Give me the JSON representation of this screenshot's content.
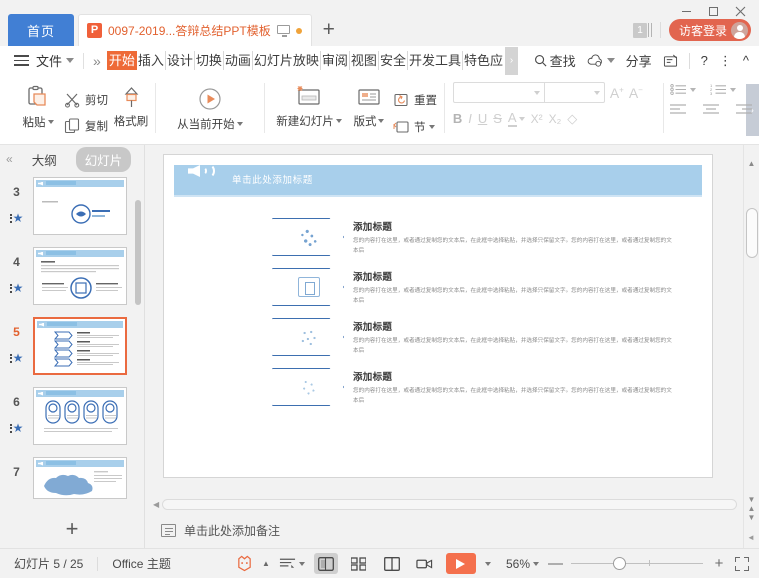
{
  "titlebar": {
    "home_tab": "首页",
    "doc_tab": {
      "badge": "P",
      "title": "0097-2019...答辩总结PPT模板"
    },
    "new_tab": "+",
    "window_count": "1",
    "guest_button": "访客登录",
    "minimize": "—",
    "maximize": "□",
    "close": "✕"
  },
  "ribbon": {
    "file_menu": "文件",
    "overflow_left": "»",
    "overflow_right": "›",
    "tabs": [
      {
        "label": "开始",
        "active": true
      },
      {
        "label": "插入",
        "active": false
      },
      {
        "label": "设计",
        "active": false
      },
      {
        "label": "切换",
        "active": false
      },
      {
        "label": "动画",
        "active": false
      },
      {
        "label": "幻灯片放映",
        "active": false
      },
      {
        "label": "审阅",
        "active": false
      },
      {
        "label": "视图",
        "active": false
      },
      {
        "label": "安全",
        "active": false
      },
      {
        "label": "开发工具",
        "active": false
      },
      {
        "label": "特色应",
        "active": false
      }
    ],
    "right_actions": [
      {
        "label": "查找",
        "icon": "search-icon"
      },
      {
        "label": "",
        "icon": "cloud-sync-icon"
      },
      {
        "label": "分享",
        "icon": "share-icon"
      },
      {
        "label": "",
        "icon": "comment-icon"
      },
      {
        "label": "?",
        "icon": "help-icon"
      },
      {
        "label": "⋮",
        "icon": "more-icon"
      },
      {
        "label": "^",
        "icon": "collapse-ribbon-icon"
      }
    ],
    "clipboard": {
      "paste": "粘贴",
      "cut": "剪切",
      "copy": "复制",
      "format_painter": "格式刷"
    },
    "slideshow": {
      "start_from_current": "从当前开始"
    },
    "slides": {
      "new_slide": "新建幻灯片",
      "layout": "版式",
      "reset": "重置",
      "section": "节"
    },
    "font": {
      "font_name_value": "",
      "font_size_value": "",
      "grow_font": "A",
      "shrink_font": "A",
      "bold": "B",
      "italic": "I",
      "underline": "U",
      "strikethrough": "S",
      "text_color": "A",
      "superscript": "X²",
      "subscript": "X₂",
      "clear_format": "◇"
    },
    "paragraph": {
      "bullets": "bullet-list-icon",
      "numbering": "numbered-list-icon",
      "align_left": "align-left-icon",
      "align_center": "align-center-icon",
      "align_right": "align-right-icon"
    }
  },
  "left_panel": {
    "collapse": "«",
    "tab_outline": "大纲",
    "tab_slides": "幻灯片",
    "selected_tab": "幻灯片",
    "add_slide": "+",
    "thumbnails": [
      {
        "number": "3",
        "selected": false
      },
      {
        "number": "4",
        "selected": false
      },
      {
        "number": "5",
        "selected": true
      },
      {
        "number": "6",
        "selected": false
      },
      {
        "number": "7",
        "selected": false
      }
    ]
  },
  "slide": {
    "title_placeholder": "单击此处添加标题",
    "items": [
      {
        "heading": "添加标题",
        "body": "您的内容打在这里，或者通过复制您的文本后，在此框中选择粘贴，并选择只保留文字。您的内容打在这里，或者通过复制您的文本后"
      },
      {
        "heading": "添加标题",
        "body": "您的内容打在这里，或者通过复制您的文本后，在此框中选择粘贴，并选择只保留文字。您的内容打在这里，或者通过复制您的文本后"
      },
      {
        "heading": "添加标题",
        "body": "您的内容打在这里，或者通过复制您的文本后，在此框中选择粘贴，并选择只保留文字。您的内容打在这里，或者通过复制您的文本后"
      },
      {
        "heading": "添加标题",
        "body": "您的内容打在这里，或者通过复制您的文本后，在此框中选择粘贴，并选择只保留文字。您的内容打在这里，或者通过复制您的文本后"
      }
    ]
  },
  "notes": {
    "placeholder": "单击此处添加备注"
  },
  "statusbar": {
    "slide_counter": "幻灯片 5 / 25",
    "theme": "Office 主题",
    "zoom_value": "56%",
    "zoom_minus": "—",
    "zoom_plus": "+",
    "play_label": "▶",
    "views": [
      {
        "name": "normal-view",
        "active": true
      },
      {
        "name": "slide-sorter-view",
        "active": false
      },
      {
        "name": "reading-view",
        "active": false
      },
      {
        "name": "presenter-view",
        "active": false
      }
    ]
  },
  "colors": {
    "accent_orange": "#ee6a37",
    "accent_blue": "#417fd4",
    "slide_banner": "#a8cfeb",
    "selected_thumb_border": "#ea6a40",
    "guest_button": "#e2654f"
  }
}
